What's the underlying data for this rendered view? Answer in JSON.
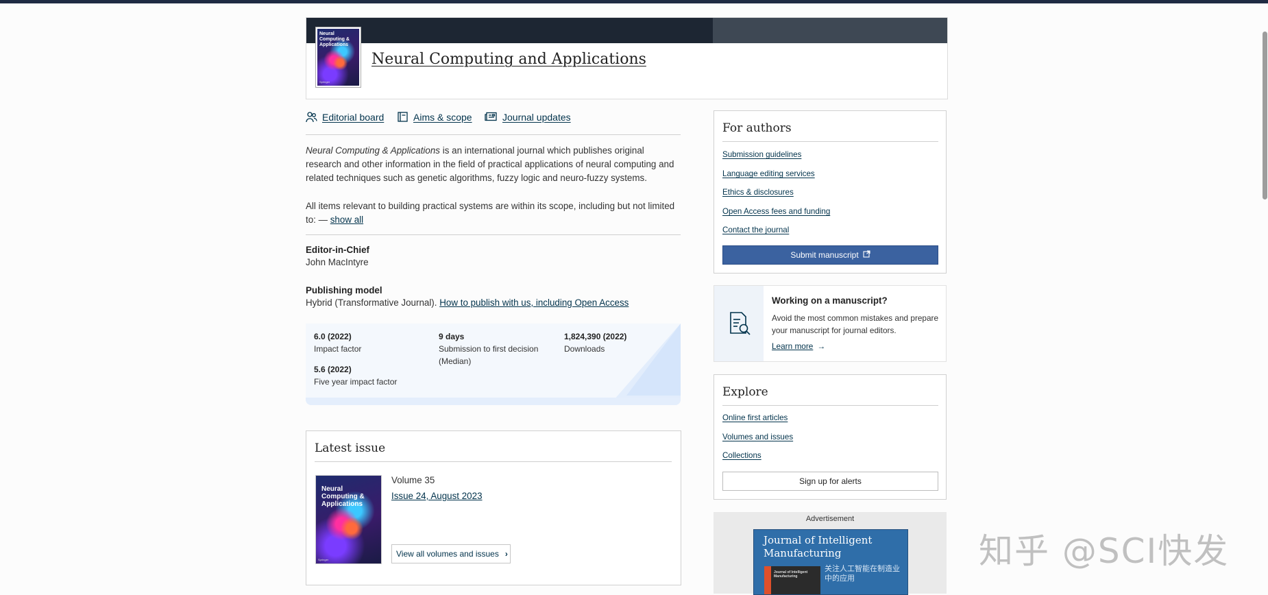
{
  "journal": {
    "title": "Neural Computing and Applications",
    "cover_title": "Neural Computing & Applications",
    "cover_publisher": "Springer"
  },
  "nav": [
    {
      "label": "Editorial board",
      "icon": "people-icon"
    },
    {
      "label": "Aims & scope",
      "icon": "book-icon"
    },
    {
      "label": "Journal updates",
      "icon": "news-icon"
    }
  ],
  "description": {
    "journal_name": "Neural Computing & Applications",
    "para1_rest": " is an international journal which publishes original research and other information in the field of practical applications of neural computing and related techniques such as genetic algorithms, fuzzy logic and neuro-fuzzy systems.",
    "para2": "All items relevant to building practical systems are within its scope, including but not limited to: — ",
    "show_all": "show all"
  },
  "editor": {
    "heading": "Editor-in-Chief",
    "name": "John MacIntyre"
  },
  "publishing": {
    "heading": "Publishing model",
    "text": "Hybrid (Transformative Journal). ",
    "link": "How to publish with us, including Open Access"
  },
  "metrics": [
    {
      "value": "6.0 (2022)",
      "label": "Impact factor"
    },
    {
      "value": "9 days",
      "label": "Submission to first decision",
      "label2": "(Median)"
    },
    {
      "value": "1,824,390 (2022)",
      "label": "Downloads"
    },
    {
      "value": "5.6 (2022)",
      "label": "Five year impact factor"
    }
  ],
  "latest": {
    "heading": "Latest issue",
    "volume": "Volume 35",
    "issue": "Issue 24, August 2023",
    "view_all": "View all volumes and issues"
  },
  "for_authors": {
    "heading": "For authors",
    "links": [
      "Submission guidelines",
      "Language editing services",
      "Ethics & disclosures",
      "Open Access fees and funding",
      "Contact the journal"
    ],
    "submit": "Submit manuscript"
  },
  "working": {
    "heading": "Working on a manuscript?",
    "text": "Avoid the most common mistakes and prepare your manuscript for journal editors.",
    "link": "Learn more",
    "arrow": "→"
  },
  "explore": {
    "heading": "Explore",
    "links": [
      "Online first articles",
      "Volumes and issues",
      "Collections"
    ],
    "alerts": "Sign up for alerts"
  },
  "advert": {
    "label": "Advertisement",
    "title": "Journal of Intelligent Manufacturing",
    "cn_text": "关注人工智能在制造业中的应用",
    "book_text": "Journal of Intelligent Manufacturing"
  },
  "watermark": "知乎 @SCI快发",
  "colors": {
    "link": "#01324b",
    "button": "#3b62a0",
    "header_dark": "#1d2633"
  }
}
